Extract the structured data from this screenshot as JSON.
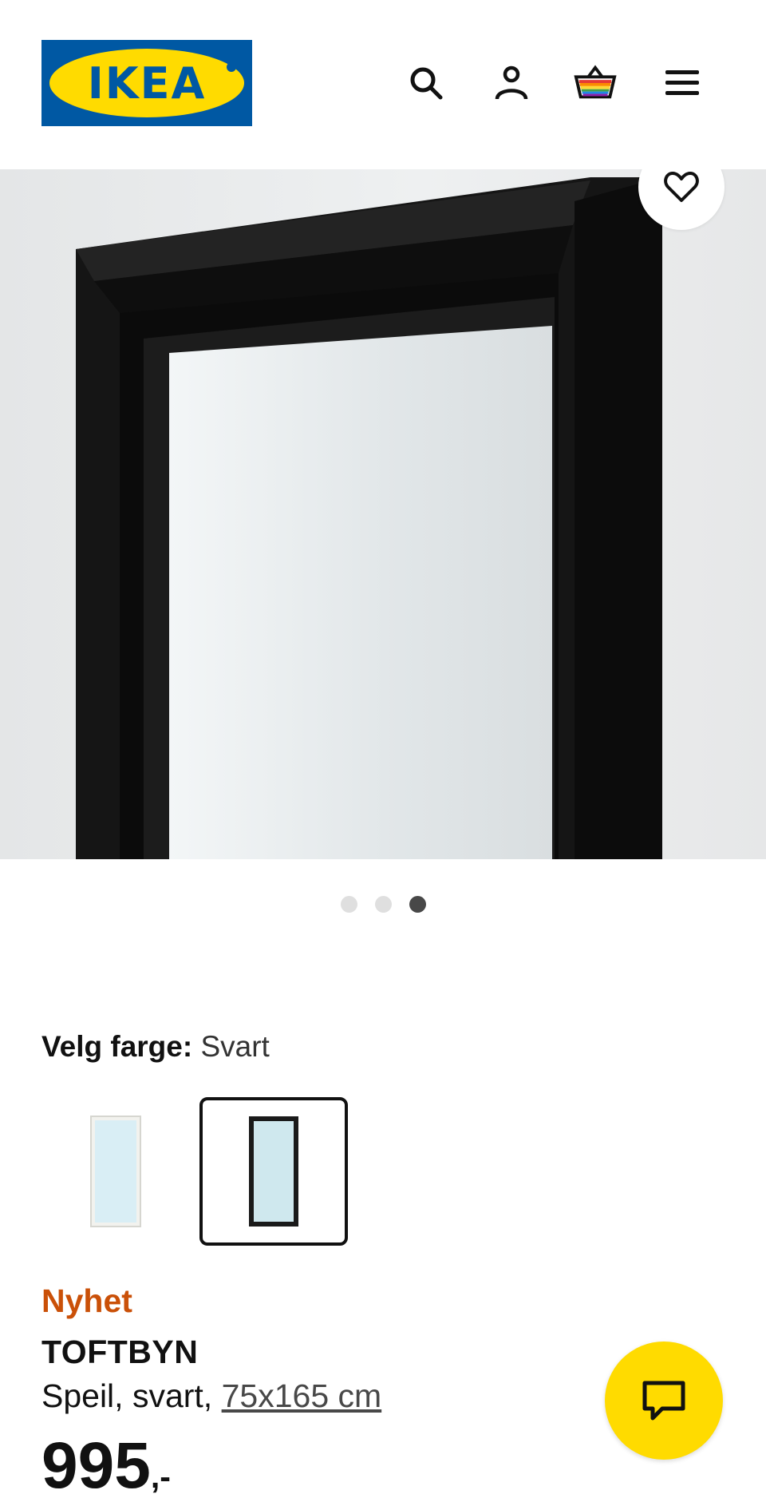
{
  "header": {
    "logo_text": "IKEA",
    "icons": [
      "search-icon",
      "account-icon",
      "basket-icon",
      "menu-icon"
    ]
  },
  "gallery": {
    "dot_count": 3,
    "active_dot_index": 2
  },
  "color_picker": {
    "label": "Velg farge:",
    "selected_value": "Svart",
    "options": [
      {
        "name": "white",
        "frame_color": "#f2f2ee",
        "selected": false
      },
      {
        "name": "black",
        "frame_color": "#1a1a1a",
        "selected": true
      }
    ]
  },
  "product": {
    "badge": "Nyhet",
    "name": "TOFTBYN",
    "description": "Speil, svart,",
    "dimensions": "75x165 cm",
    "price_main": "995",
    "price_suffix": ",-"
  },
  "colors": {
    "brand_blue": "#0058a3",
    "brand_yellow": "#ffdb00",
    "new_badge": "#ca5008"
  }
}
